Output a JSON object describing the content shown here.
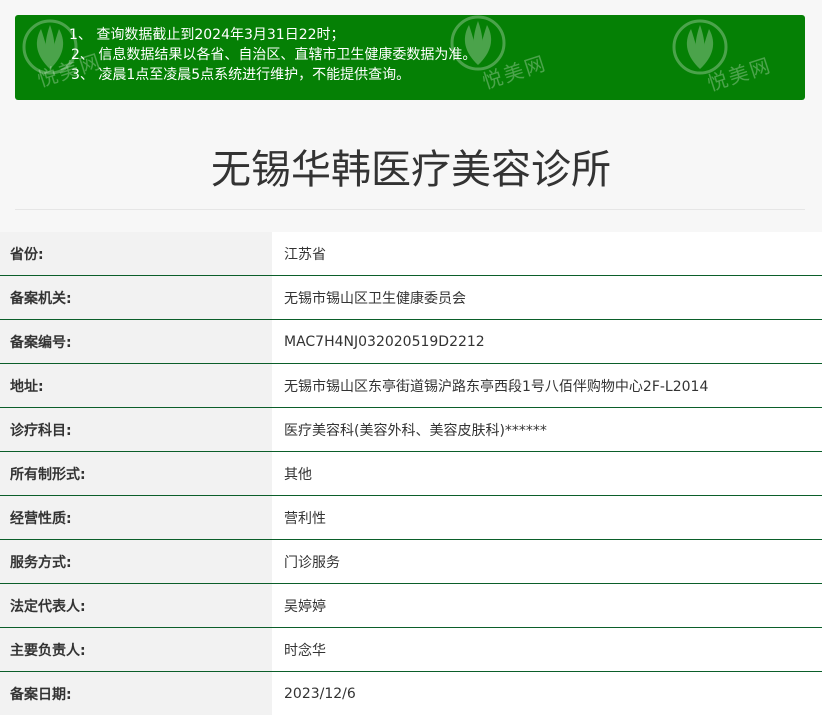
{
  "notice": {
    "lines": [
      "1、 查询数据截止到2024年3月31日22时；",
      "2、 信息数据结果以各省、自治区、直辖市卫生健康委数据为准。",
      "3、 凌晨1点至凌晨5点系统进行维护，不能提供查询。"
    ],
    "watermark_text": "悦美网",
    "watermark_icon": "yuemei-logo-icon",
    "background_color": "#058005"
  },
  "title": "无锡华韩医疗美容诊所",
  "details": [
    {
      "label": "省份:",
      "value": "江苏省"
    },
    {
      "label": "备案机关:",
      "value": "无锡市锡山区卫生健康委员会"
    },
    {
      "label": "备案编号:",
      "value": "MAC7H4NJ032020519D2212"
    },
    {
      "label": "地址:",
      "value": "无锡市锡山区东亭街道锡沪路东亭西段1号八佰伴购物中心2F-L2014"
    },
    {
      "label": "诊疗科目:",
      "value": "医疗美容科(美容外科、美容皮肤科)******"
    },
    {
      "label": "所有制形式:",
      "value": "其他"
    },
    {
      "label": "经营性质:",
      "value": "营利性"
    },
    {
      "label": "服务方式:",
      "value": "门诊服务"
    },
    {
      "label": "法定代表人:",
      "value": "吴婷婷"
    },
    {
      "label": "主要负责人:",
      "value": "时念华"
    },
    {
      "label": "备案日期:",
      "value": "2023/12/6"
    }
  ],
  "colors": {
    "row_divider": "#0b5e2a",
    "label_bg": "#f2f2f2",
    "value_bg": "#ffffff"
  }
}
